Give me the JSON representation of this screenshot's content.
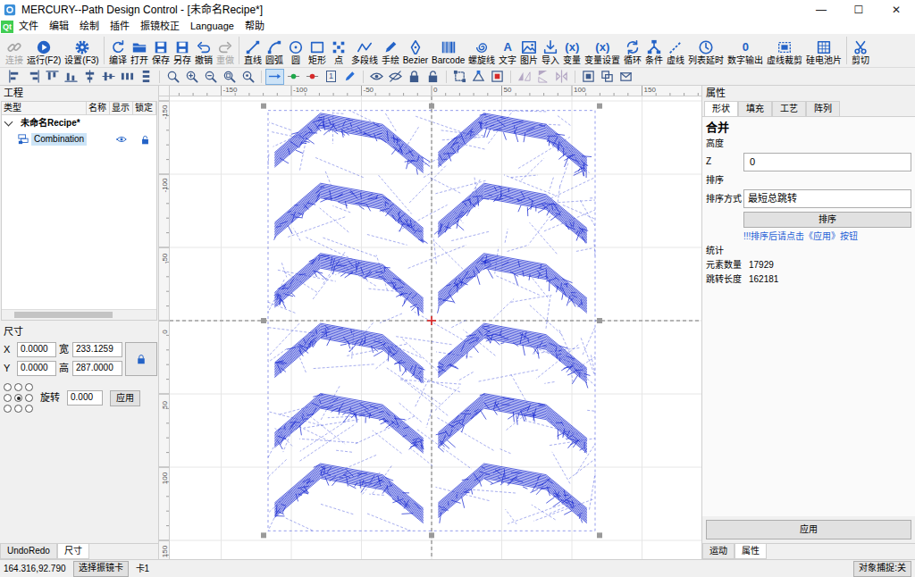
{
  "window": {
    "title": "MERCURY--Path Design Control - [未命名Recipe*]",
    "controls": [
      "—",
      "☐",
      "✕"
    ]
  },
  "menu": {
    "logo": "Qt",
    "items": [
      "文件",
      "编辑",
      "绘制",
      "插件",
      "振镜校正",
      "Language",
      "帮助"
    ]
  },
  "toolbar": [
    [
      {
        "label": "连接",
        "disabled": true
      },
      {
        "label": "运行(F2)",
        "disabled": false
      },
      {
        "label": "设置(F3)",
        "disabled": false
      }
    ],
    [
      {
        "label": "编译",
        "disabled": false
      },
      {
        "label": "打开",
        "disabled": false
      },
      {
        "label": "保存",
        "disabled": false
      },
      {
        "label": "另存",
        "disabled": false
      },
      {
        "label": "撤销",
        "disabled": false
      },
      {
        "label": "重做",
        "disabled": true
      }
    ],
    [
      {
        "label": "直线",
        "disabled": false
      },
      {
        "label": "圆弧",
        "disabled": false
      },
      {
        "label": "圆",
        "disabled": false
      },
      {
        "label": "矩形",
        "disabled": false
      },
      {
        "label": "点",
        "disabled": false
      },
      {
        "label": "多段线",
        "disabled": false
      },
      {
        "label": "手绘",
        "disabled": false
      },
      {
        "label": "Bezier",
        "disabled": false
      },
      {
        "label": "Barcode",
        "disabled": false
      },
      {
        "label": "螺旋线",
        "disabled": false
      },
      {
        "label": "文字",
        "disabled": false,
        "glyph": "A"
      },
      {
        "label": "图片",
        "disabled": false
      },
      {
        "label": "导入",
        "disabled": false
      },
      {
        "label": "变量",
        "disabled": false,
        "glyph": "(x)"
      },
      {
        "label": "变量设置",
        "disabled": false,
        "glyph": "(x)"
      },
      {
        "label": "循环",
        "disabled": false
      },
      {
        "label": "条件",
        "disabled": false
      },
      {
        "label": "虚线",
        "disabled": false
      },
      {
        "label": "列表延时",
        "disabled": false
      },
      {
        "label": "数字输出",
        "disabled": false,
        "glyph": "0"
      },
      {
        "label": "虚线裁剪",
        "disabled": false
      },
      {
        "label": "硅电池片",
        "disabled": false
      }
    ],
    [
      {
        "label": "剪切",
        "disabled": false
      }
    ]
  ],
  "toolbar2": [
    [
      {
        "kind": "icon",
        "selected": false,
        "disabled": false
      },
      {
        "kind": "icon",
        "selected": false,
        "disabled": false
      },
      {
        "kind": "icon",
        "selected": false,
        "disabled": false
      },
      {
        "kind": "icon",
        "selected": false,
        "disabled": false
      },
      {
        "kind": "icon",
        "selected": false,
        "disabled": false
      },
      {
        "kind": "icon",
        "selected": false,
        "disabled": false
      },
      {
        "kind": "icon",
        "selected": false,
        "disabled": false
      },
      {
        "kind": "icon",
        "selected": false,
        "disabled": false
      }
    ],
    [
      {
        "kind": "icon",
        "selected": false,
        "disabled": false
      },
      {
        "kind": "icon",
        "selected": false,
        "disabled": false
      },
      {
        "kind": "icon",
        "selected": false,
        "disabled": false
      },
      {
        "kind": "icon",
        "selected": false,
        "disabled": false
      },
      {
        "kind": "icon",
        "selected": false,
        "disabled": false
      }
    ],
    [
      {
        "kind": "icon",
        "selected": true,
        "disabled": false
      },
      {
        "kind": "icon",
        "selected": false,
        "disabled": false
      },
      {
        "kind": "icon",
        "selected": false,
        "disabled": false
      },
      {
        "kind": "number",
        "text": "1",
        "selected": false,
        "disabled": false
      },
      {
        "kind": "icon",
        "selected": false,
        "disabled": false
      }
    ],
    [
      {
        "kind": "icon",
        "selected": false,
        "disabled": false
      },
      {
        "kind": "icon",
        "selected": false,
        "disabled": false
      },
      {
        "kind": "icon",
        "selected": false,
        "disabled": false
      },
      {
        "kind": "icon",
        "selected": false,
        "disabled": false
      }
    ],
    [
      {
        "kind": "icon",
        "selected": false,
        "disabled": false
      },
      {
        "kind": "icon",
        "selected": false,
        "disabled": false
      },
      {
        "kind": "icon",
        "selected": false,
        "disabled": false
      }
    ],
    [
      {
        "kind": "icon",
        "selected": false,
        "disabled": true
      },
      {
        "kind": "icon",
        "selected": false,
        "disabled": true
      },
      {
        "kind": "icon",
        "selected": false,
        "disabled": true
      }
    ],
    [
      {
        "kind": "icon",
        "selected": false,
        "disabled": false
      },
      {
        "kind": "icon",
        "selected": false,
        "disabled": false
      },
      {
        "kind": "icon",
        "selected": false,
        "disabled": false
      }
    ]
  ],
  "project": {
    "title": "工程",
    "columns": [
      "类型",
      "名称",
      "显示",
      "锁定"
    ],
    "rows": [
      {
        "label": "未命名Recipe*",
        "expanded": true,
        "selected": false
      },
      {
        "label": "Combination",
        "selected": true,
        "visible": true,
        "locked": false
      }
    ]
  },
  "size": {
    "title": "尺寸",
    "fields": [
      {
        "label": "X",
        "value": "0.0000"
      },
      {
        "label": "宽",
        "value": "233.1259"
      },
      {
        "label": "Y",
        "value": "0.0000"
      },
      {
        "label": "高",
        "value": "287.0000"
      }
    ],
    "anchors": [
      {
        "selected": false
      },
      {
        "selected": false
      },
      {
        "selected": false
      },
      {
        "selected": false
      },
      {
        "selected": true
      },
      {
        "selected": false
      },
      {
        "selected": false
      },
      {
        "selected": false
      },
      {
        "selected": false
      }
    ],
    "rotation": {
      "label": "旋转",
      "value": "0.000"
    },
    "apply": "应用"
  },
  "left_tabs": [
    {
      "label": "UndoRedo",
      "selected": false
    },
    {
      "label": "尺寸",
      "selected": true
    }
  ],
  "canvas": {
    "x_ticks": [
      "-150",
      "-100",
      "-50",
      "0",
      "50",
      "100",
      "150"
    ],
    "y_ticks": [
      "-150",
      "-100",
      "-50",
      "0",
      "50",
      "100",
      "150"
    ]
  },
  "properties": {
    "title": "属性",
    "tabs": [
      {
        "label": "形状",
        "selected": true
      },
      {
        "label": "填充",
        "selected": false
      },
      {
        "label": "工艺",
        "selected": false
      },
      {
        "label": "阵列",
        "selected": false
      }
    ],
    "heading": "合并",
    "height_label": "高度",
    "z_label": "Z",
    "z_value": "0",
    "sort_label": "排序",
    "sort_mode_label": "排序方式",
    "sort_mode": "最短总跳转",
    "sort_button": "排序",
    "sort_hint": "!!!排序后请点击《应用》按钮",
    "stats_label": "统计",
    "stats": [
      {
        "label": "元素数量",
        "value": "17929"
      },
      {
        "label": "跳转长度",
        "value": "162181"
      }
    ],
    "apply": "应用"
  },
  "right_tabs": [
    {
      "label": "运动",
      "selected": false
    },
    {
      "label": "属性",
      "selected": true
    }
  ],
  "status_bar": {
    "coords": "164.316,92.790",
    "card_button": "选择振镜卡",
    "card": "卡1",
    "snap_button": "对象捕捉:关"
  }
}
